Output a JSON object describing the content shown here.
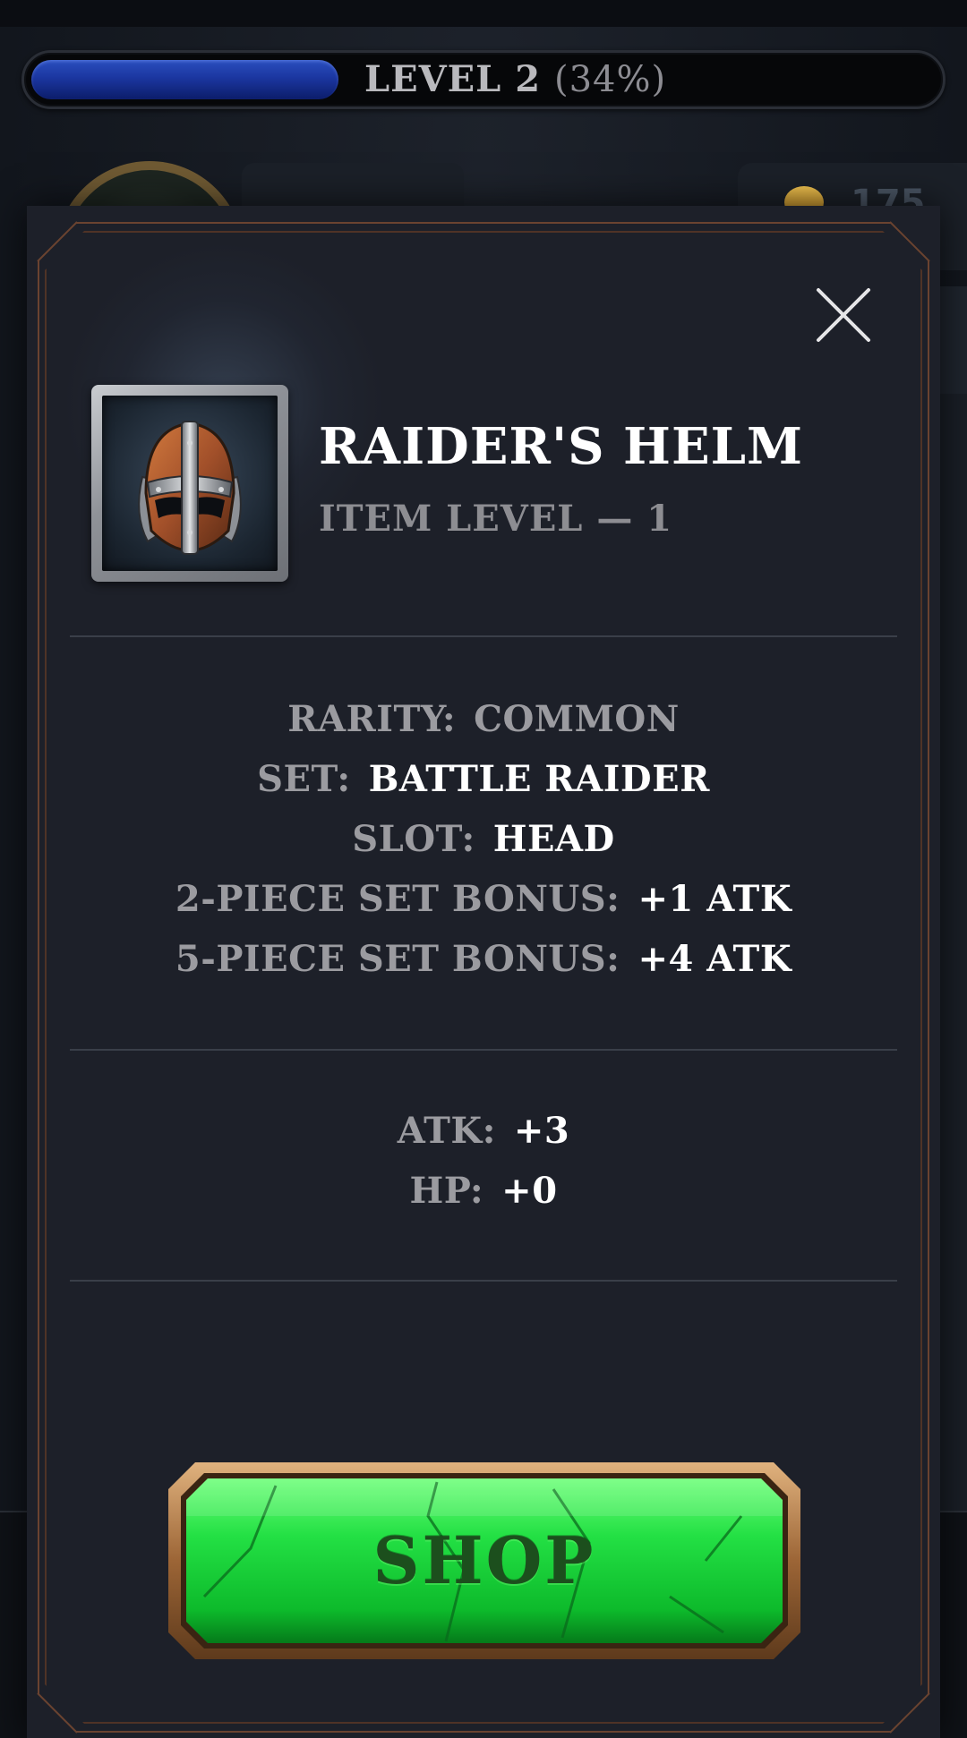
{
  "hud": {
    "level_label": "LEVEL 2",
    "level_percent": "(34%)",
    "level_progress": 0.34,
    "coin_count_partial": "175"
  },
  "modal": {
    "close_icon": "close-icon",
    "item_icon": "knight-helmet-icon",
    "title": "RAIDER'S HELM",
    "item_level": "ITEM LEVEL — 1",
    "attributes": [
      {
        "key": "RARITY:",
        "value": "COMMON",
        "value_muted": true
      },
      {
        "key": "SET:",
        "value": "BATTLE RAIDER",
        "value_muted": false
      },
      {
        "key": "SLOT:",
        "value": "HEAD",
        "value_muted": false
      },
      {
        "key": "2-PIECE SET BONUS:",
        "value": "+1 ATK",
        "value_muted": false
      },
      {
        "key": "5-PIECE SET BONUS:",
        "value": "+4 ATK",
        "value_muted": false
      }
    ],
    "stats": [
      {
        "key": "ATK:",
        "value": "+3"
      },
      {
        "key": "HP:",
        "value": "+0"
      }
    ],
    "shop_button_label": "SHOP"
  },
  "colors": {
    "modal_bg": "#1d2029",
    "frame": "#6a4330",
    "xp_fill": "#1b36a0",
    "shop_green": "#1fd23a",
    "shop_rim": "#b07a4a"
  }
}
